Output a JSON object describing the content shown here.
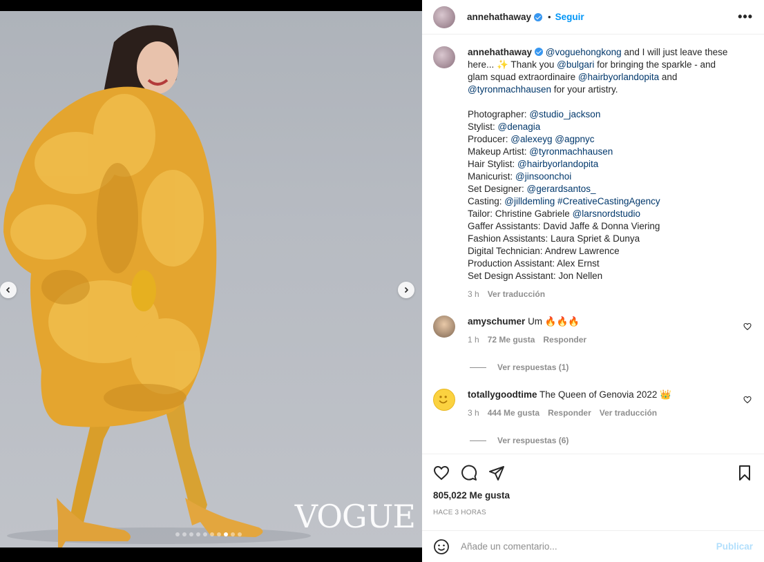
{
  "post": {
    "username": "annehathaway",
    "separator": "•",
    "follow_label": "Seguir",
    "more_label": "•••",
    "watermark": "VOGUE",
    "carousel": {
      "count": 10,
      "active_index": 7
    }
  },
  "caption": {
    "username": "annehathaway",
    "parts": {
      "m1": "@voguehongkong",
      "t1": " and I will just leave these",
      "t2": "here... ✨ Thank you ",
      "m2": "@bulgari",
      "t3": " for bringing the sparkle - and",
      "t4": "glam squad extraordinaire ",
      "m3": "@hairbyorlandopita",
      "t5": " and",
      "m4": "@tyronmachhausen",
      "t6": " for your artistry."
    },
    "credits": [
      {
        "label": "Photographer: ",
        "value": "@studio_jackson"
      },
      {
        "label": "Stylist: ",
        "value": "@denagia"
      },
      {
        "label": "Producer: ",
        "value": "@alexeyg @agpnyc"
      },
      {
        "label": "Makeup Artist: ",
        "value": "@tyronmachhausen"
      },
      {
        "label": "Hair Stylist: ",
        "value": "@hairbyorlandopita"
      },
      {
        "label": "Manicurist: ",
        "value": "@jinsoonchoi"
      },
      {
        "label": "Set Designer: ",
        "value": "@gerardsantos_"
      },
      {
        "label": "Casting: ",
        "value": "@jilldemling #CreativeCastingAgency"
      },
      {
        "label": "Tailor: Christine Gabriele ",
        "value": "@larsnordstudio"
      },
      {
        "label": "Gaffer Assistants: David Jaffe & Donna Viering",
        "value": ""
      },
      {
        "label": "Fashion Assistants: Laura Spriet & Dunya",
        "value": ""
      },
      {
        "label": "Digital Technician: Andrew Lawrence",
        "value": ""
      },
      {
        "label": "Production Assistant: Alex Ernst",
        "value": ""
      },
      {
        "label": "Set Design Assistant: Jon Nellen",
        "value": ""
      }
    ],
    "time": "3 h",
    "translate": "Ver traducción"
  },
  "comments": [
    {
      "username": "amyschumer",
      "text": "Um 🔥🔥🔥",
      "time": "1 h",
      "likes": "72 Me gusta",
      "reply": "Responder",
      "translate": "",
      "view_replies": "Ver respuestas (1)"
    },
    {
      "username": "totallygoodtime",
      "text": "The Queen of Genovia 2022 👑",
      "time": "3 h",
      "likes": "444 Me gusta",
      "reply": "Responder",
      "translate": "Ver traducción",
      "view_replies": "Ver respuestas (6)"
    }
  ],
  "actions": {
    "icons": [
      "heart-icon",
      "comment-icon",
      "share-icon",
      "bookmark-icon"
    ],
    "likes": "805,022 Me gusta",
    "timestamp": "HACE 3 HORAS"
  },
  "add_comment": {
    "placeholder": "Añade un comentario...",
    "publish": "Publicar"
  }
}
